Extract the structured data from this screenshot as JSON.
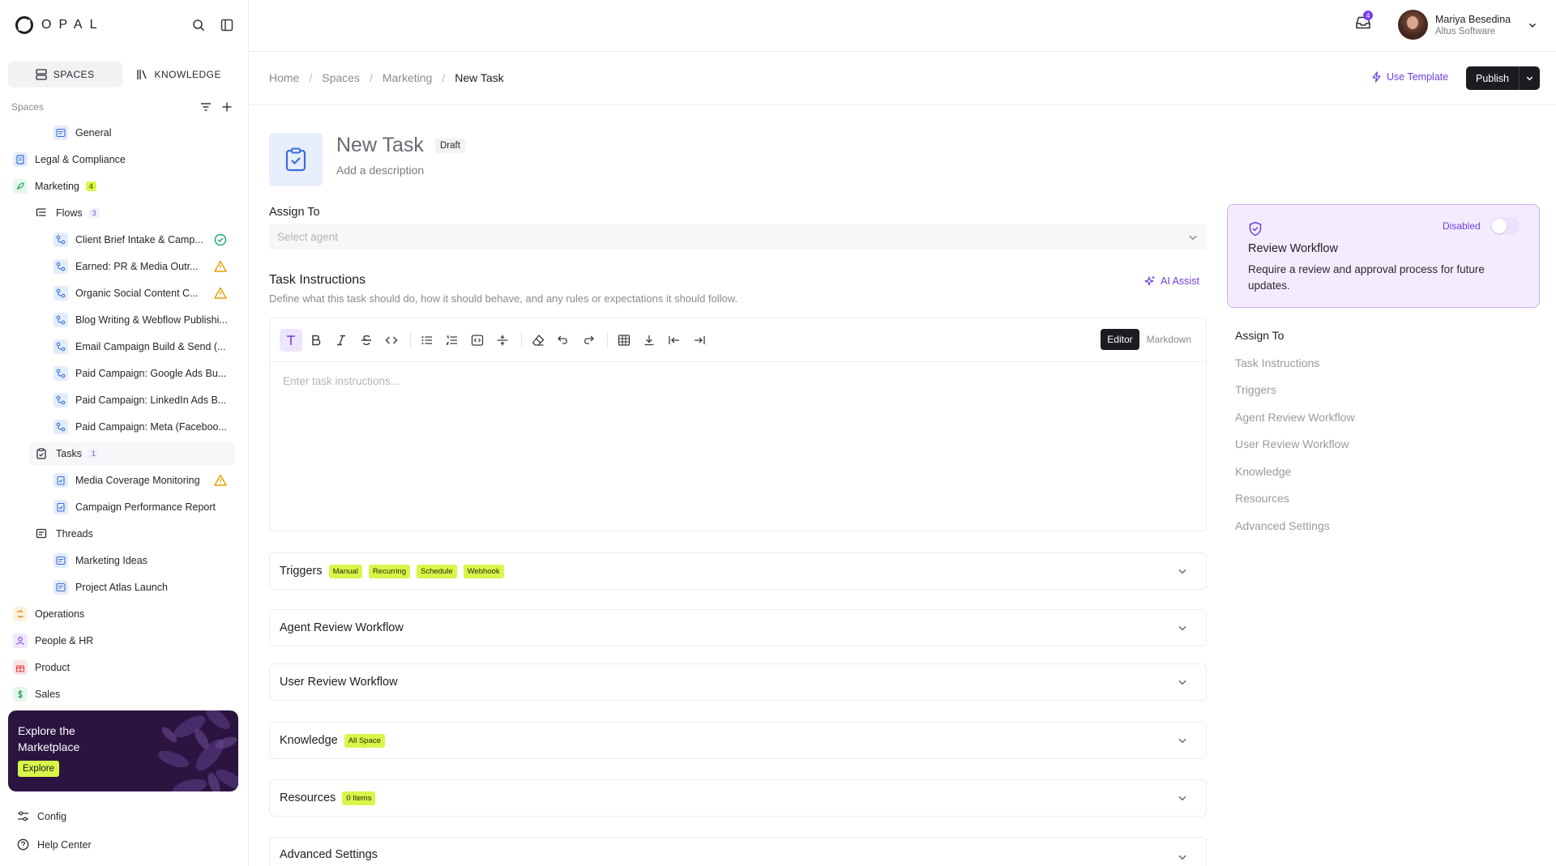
{
  "app": {
    "logo_text": "OPAL"
  },
  "sidebar": {
    "tabs": [
      {
        "label": "SPACES"
      },
      {
        "label": "KNOWLEDGE"
      }
    ],
    "spaces_label": "Spaces",
    "items": [
      {
        "label": "General"
      },
      {
        "label": "Legal & Compliance"
      },
      {
        "label": "Marketing",
        "count": "4"
      },
      {
        "label": "Flows",
        "count": "3"
      },
      {
        "label": "Client Brief Intake & Camp..."
      },
      {
        "label": "Earned: PR & Media Outr..."
      },
      {
        "label": "Organic Social Content C..."
      },
      {
        "label": "Blog Writing & Webflow Publishi..."
      },
      {
        "label": "Email Campaign Build & Send (..."
      },
      {
        "label": "Paid Campaign: Google Ads Bu..."
      },
      {
        "label": "Paid Campaign: LinkedIn Ads B..."
      },
      {
        "label": "Paid Campaign: Meta (Faceboo..."
      },
      {
        "label": "Tasks",
        "count": "1"
      },
      {
        "label": "Media Coverage Monitoring"
      },
      {
        "label": "Campaign Performance Report"
      },
      {
        "label": "Threads"
      },
      {
        "label": "Marketing Ideas"
      },
      {
        "label": "Project Atlas Launch"
      },
      {
        "label": "Operations"
      },
      {
        "label": "People & HR"
      },
      {
        "label": "Product"
      },
      {
        "label": "Sales"
      }
    ],
    "promo": {
      "title": "Explore the Marketplace",
      "button": "Explore"
    },
    "bottom": [
      {
        "label": "Config"
      },
      {
        "label": "Help Center"
      }
    ]
  },
  "header": {
    "notification_count": "4",
    "user": {
      "name": "Mariya Besedina",
      "org": "Altus Software"
    }
  },
  "breadcrumb": {
    "items": [
      "Home",
      "Spaces",
      "Marketing",
      "New Task"
    ],
    "separator": "/",
    "use_template": "Use Template",
    "publish": "Publish"
  },
  "task": {
    "title": "New Task",
    "status": "Draft",
    "description_placeholder": "Add a description",
    "assign_label": "Assign To",
    "assign_placeholder": "Select agent",
    "instructions_label": "Task Instructions",
    "instructions_help": "Define what this task should do, how it should behave, and any rules or expectations it should follow.",
    "ai_assist": "AI Assist",
    "editor_placeholder": "Enter task instructions...",
    "mode_editor": "Editor",
    "mode_markdown": "Markdown"
  },
  "sections": [
    {
      "title": "Triggers",
      "tags": [
        "Manual",
        "Recurring",
        "Schedule",
        "Webhook"
      ]
    },
    {
      "title": "Agent Review Workflow",
      "tags": []
    },
    {
      "title": "User Review Workflow",
      "tags": []
    },
    {
      "title": "Knowledge",
      "tags": [
        "All Space"
      ]
    },
    {
      "title": "Resources",
      "tags": [
        "0 Items"
      ]
    },
    {
      "title": "Advanced Settings",
      "tags": []
    }
  ],
  "review_card": {
    "toggle_label": "Disabled",
    "toggle_on": false,
    "title": "Review Workflow",
    "description": "Require a review and approval process for future updates."
  },
  "toc": [
    "Assign To",
    "Task Instructions",
    "Triggers",
    "Agent Review Workflow",
    "User Review Workflow",
    "Knowledge",
    "Resources",
    "Advanced Settings"
  ],
  "colors": {
    "accent": "#6d3fe0",
    "lime": "#d8f64a",
    "promo_bg": "#2b1440",
    "dark": "#1c1c20"
  }
}
